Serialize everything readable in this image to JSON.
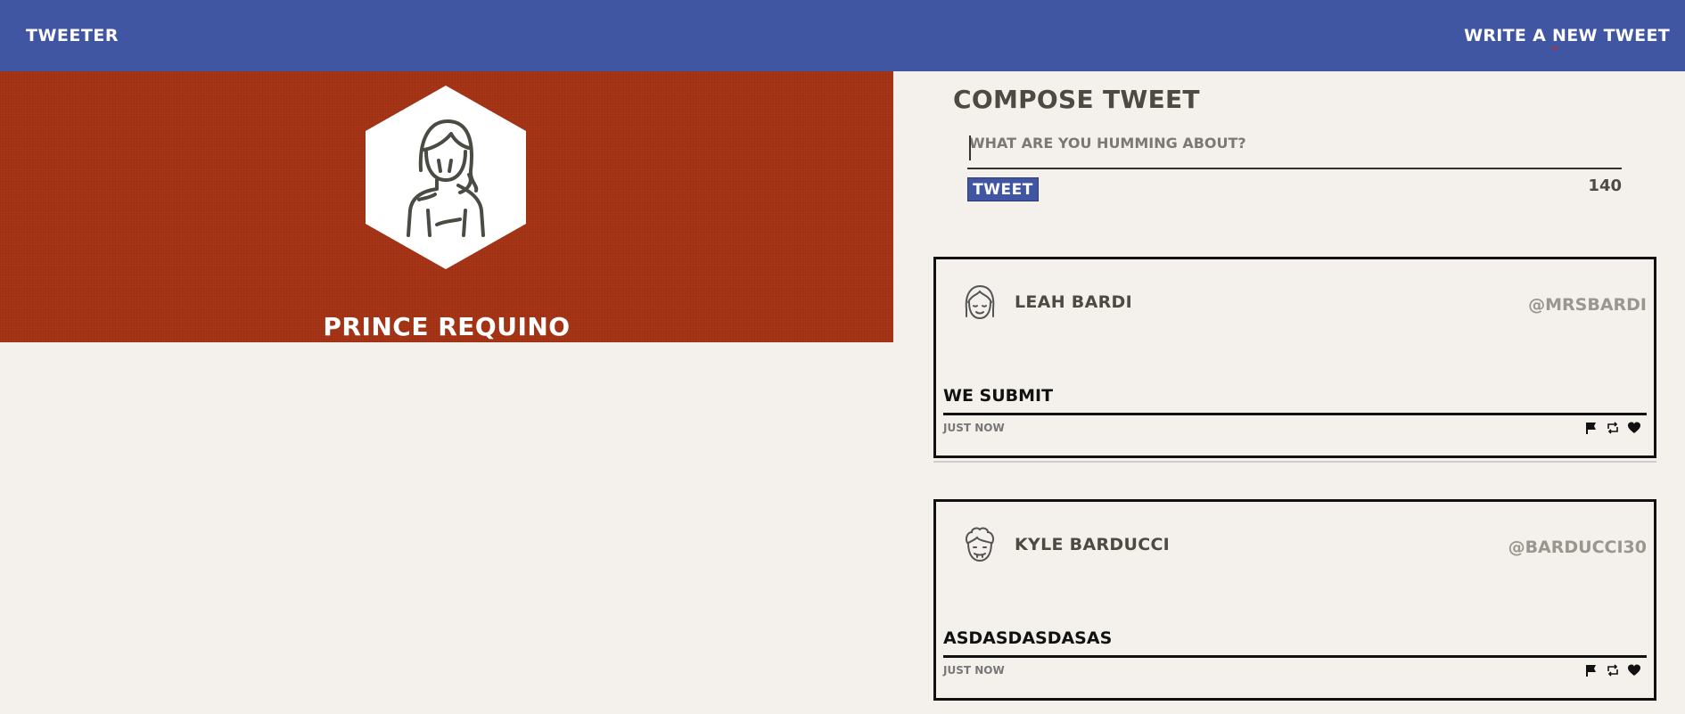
{
  "header": {
    "brand": "TWEETER",
    "write_link": "WRITE A NEW TWEET"
  },
  "profile": {
    "name": "PRINCE REQUINO",
    "avatar_icon": "woman-avatar-icon",
    "banner_color": "#a83516"
  },
  "compose": {
    "title": "COMPOSE TWEET",
    "placeholder": "WHAT ARE YOU HUMMING ABOUT?",
    "button_label": "TWEET",
    "char_count": "140"
  },
  "tweets": [
    {
      "author": "LEAH BARDI",
      "handle": "@MRSBARDI",
      "content": "WE SUBMIT",
      "time": "JUST NOW",
      "avatar_icon": "girl-face-icon"
    },
    {
      "author": "KYLE BARDUCCI",
      "handle": "@BARDUCCI30",
      "content": "ASDASDASDASAS",
      "time": "JUST NOW",
      "avatar_icon": "curly-hair-face-icon"
    }
  ],
  "colors": {
    "accent": "#4156a3",
    "background": "#f4f1ec"
  }
}
